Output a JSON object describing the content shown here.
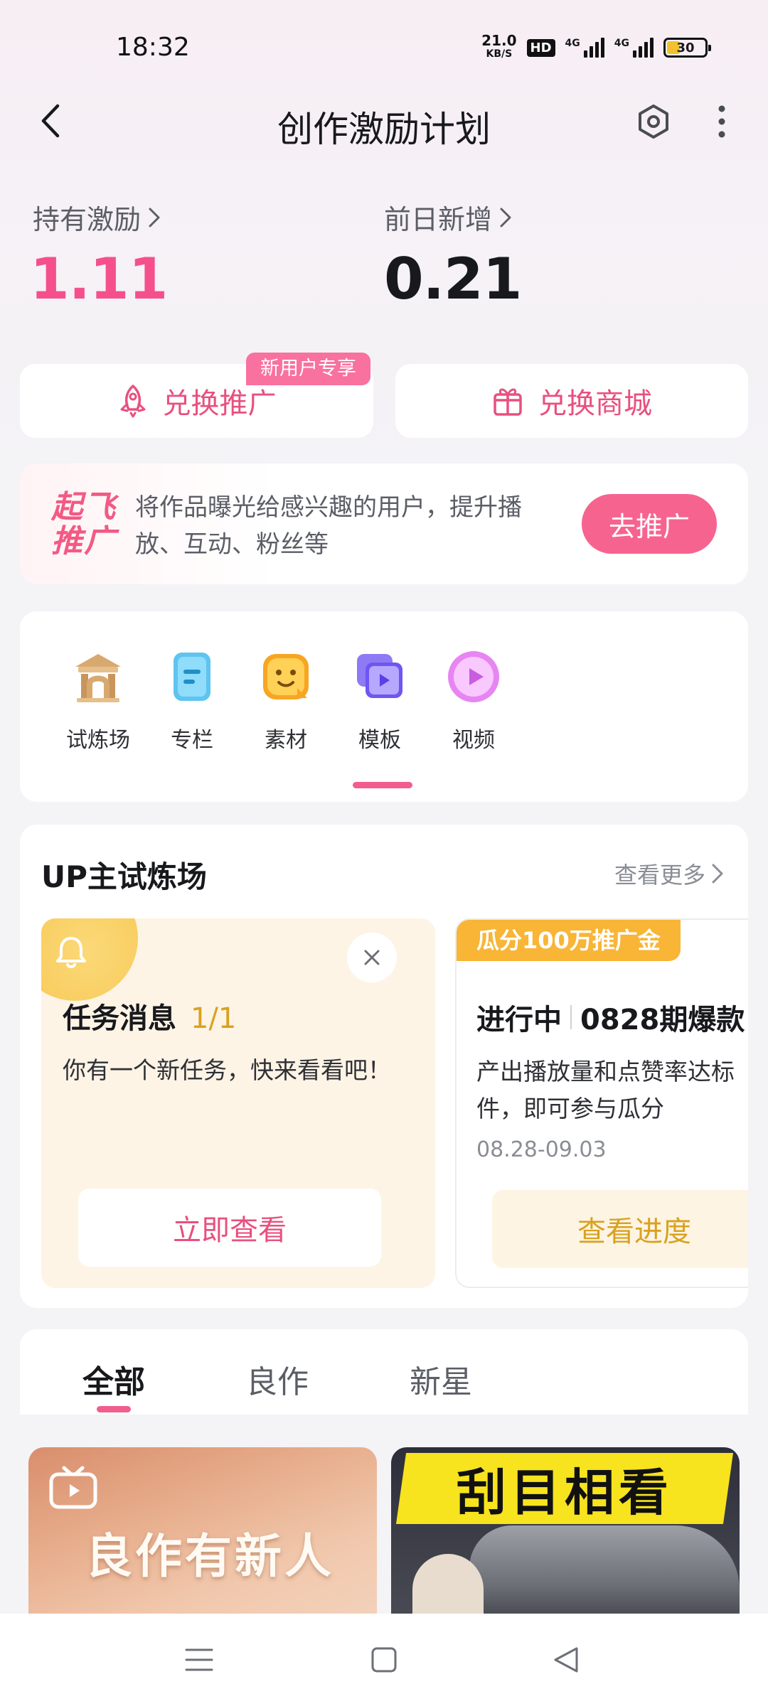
{
  "status": {
    "time": "18:32",
    "speed_value": "21.0",
    "speed_unit": "KB/S",
    "hd": "HD",
    "signal1": "4G",
    "signal2": "4G",
    "battery": "30"
  },
  "header": {
    "title": "创作激励计划"
  },
  "stats": {
    "held_label": "持有激励",
    "held_value": "1.11",
    "prev_label": "前日新增",
    "prev_value": "0.21"
  },
  "actions": {
    "promote_label": "兑换推广",
    "promote_badge": "新用户专享",
    "mall_label": "兑换商城"
  },
  "promo": {
    "logo_line1": "起飞",
    "logo_line2": "推广",
    "text": "将作品曝光给感兴趣的用户，提升播放、互动、粉丝等",
    "button": "去推广"
  },
  "categories": {
    "items": [
      {
        "label": "试炼场",
        "icon": "arena-icon"
      },
      {
        "label": "专栏",
        "icon": "article-icon"
      },
      {
        "label": "素材",
        "icon": "sticker-icon"
      },
      {
        "label": "模板",
        "icon": "template-icon"
      },
      {
        "label": "视频",
        "icon": "video-play-icon"
      }
    ],
    "active_index": 2
  },
  "trial": {
    "title": "UP主试炼场",
    "more": "查看更多",
    "task": {
      "title": "任务消息",
      "count": "1/1",
      "desc": "你有一个新任务，快来看看吧！",
      "button": "立即查看"
    },
    "event": {
      "badge": "瓜分100万推广金",
      "status": "进行中",
      "name": "0828期爆款",
      "desc": "产出播放量和点赞率达标件，即可参与瓜分",
      "date": "08.28-09.03",
      "button": "查看进度"
    }
  },
  "tabs": {
    "items": [
      "全部",
      "良作",
      "新星"
    ],
    "active_index": 0
  },
  "feed": {
    "card1_title": "良作有新人",
    "card2_title": "刮目相看"
  },
  "colors": {
    "accent_pink": "#f5508c",
    "accent_gold": "#d9a11f",
    "badge_orange": "#f8b536"
  }
}
